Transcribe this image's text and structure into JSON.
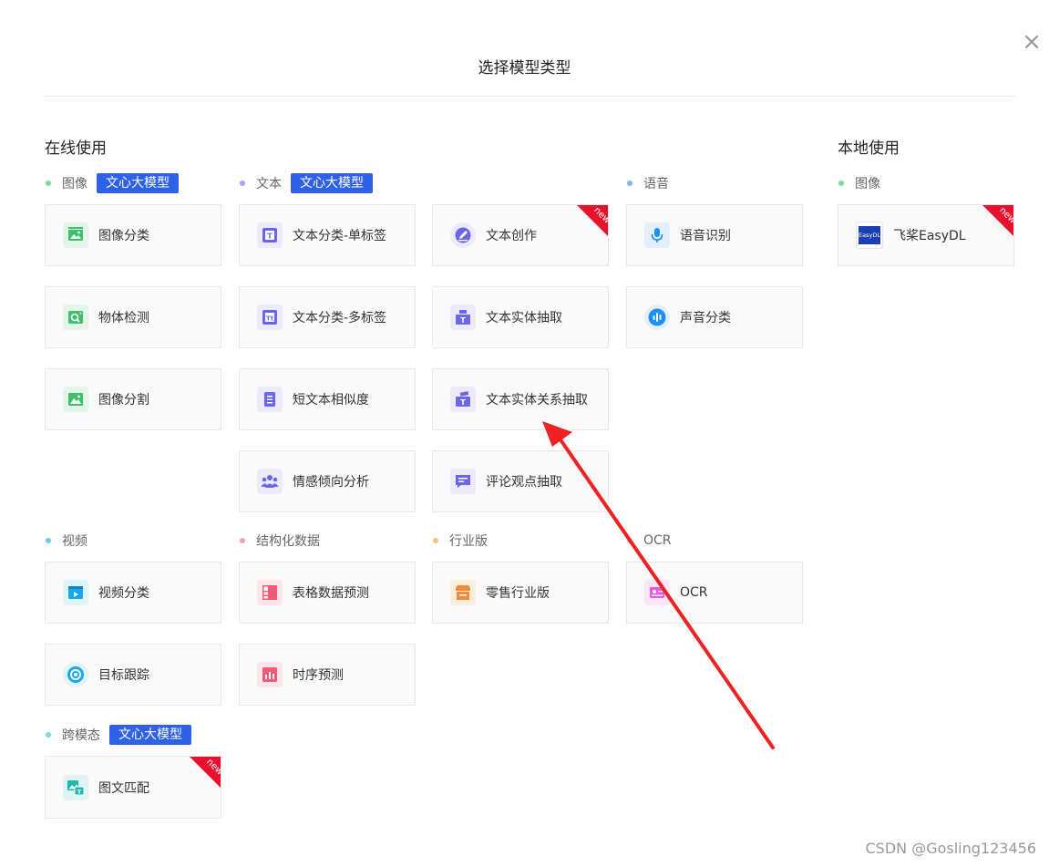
{
  "dialog": {
    "title": "选择模型类型",
    "close": "×"
  },
  "sections": {
    "online": "在线使用",
    "local": "本地使用"
  },
  "badges": {
    "llm": "文心大模型",
    "new": "new"
  },
  "groups": {
    "image": "图像",
    "text": "文本",
    "speech": "语音",
    "video": "视频",
    "structured": "结构化数据",
    "industry": "行业版",
    "ocr": "OCR",
    "crossmodal": "跨模态",
    "local_image": "图像"
  },
  "cards": {
    "image_classify": "图像分类",
    "object_detect": "物体检测",
    "image_segment": "图像分割",
    "text_single": "文本分类-单标签",
    "text_multi": "文本分类-多标签",
    "short_text_sim": "短文本相似度",
    "sentiment": "情感倾向分析",
    "text_creation": "文本创作",
    "entity_extract": "文本实体抽取",
    "relation_extract": "文本实体关系抽取",
    "opinion_extract": "评论观点抽取",
    "speech_recog": "语音识别",
    "sound_classify": "声音分类",
    "video_classify": "视频分类",
    "target_track": "目标跟踪",
    "table_predict": "表格数据预测",
    "timeseries": "时序预测",
    "retail": "零售行业版",
    "ocr": "OCR",
    "image_text_match": "图文匹配",
    "easydl": "飞桨EasyDL"
  },
  "easydl_logo": "EasyDL",
  "colors": {
    "accent": "#2e61e8",
    "new_corner": "#e8112d",
    "arrow": "#ee2222",
    "image": "#3fbf6a",
    "text": "#6b66e8",
    "speech": "#1f8ef1",
    "video": "#18a7e8",
    "structured": "#f05a74",
    "industry": "#f58a3c",
    "ocr": "#e75bdc",
    "crossmodal": "#1fb7b0"
  },
  "watermark": "CSDN @Gosling123456"
}
